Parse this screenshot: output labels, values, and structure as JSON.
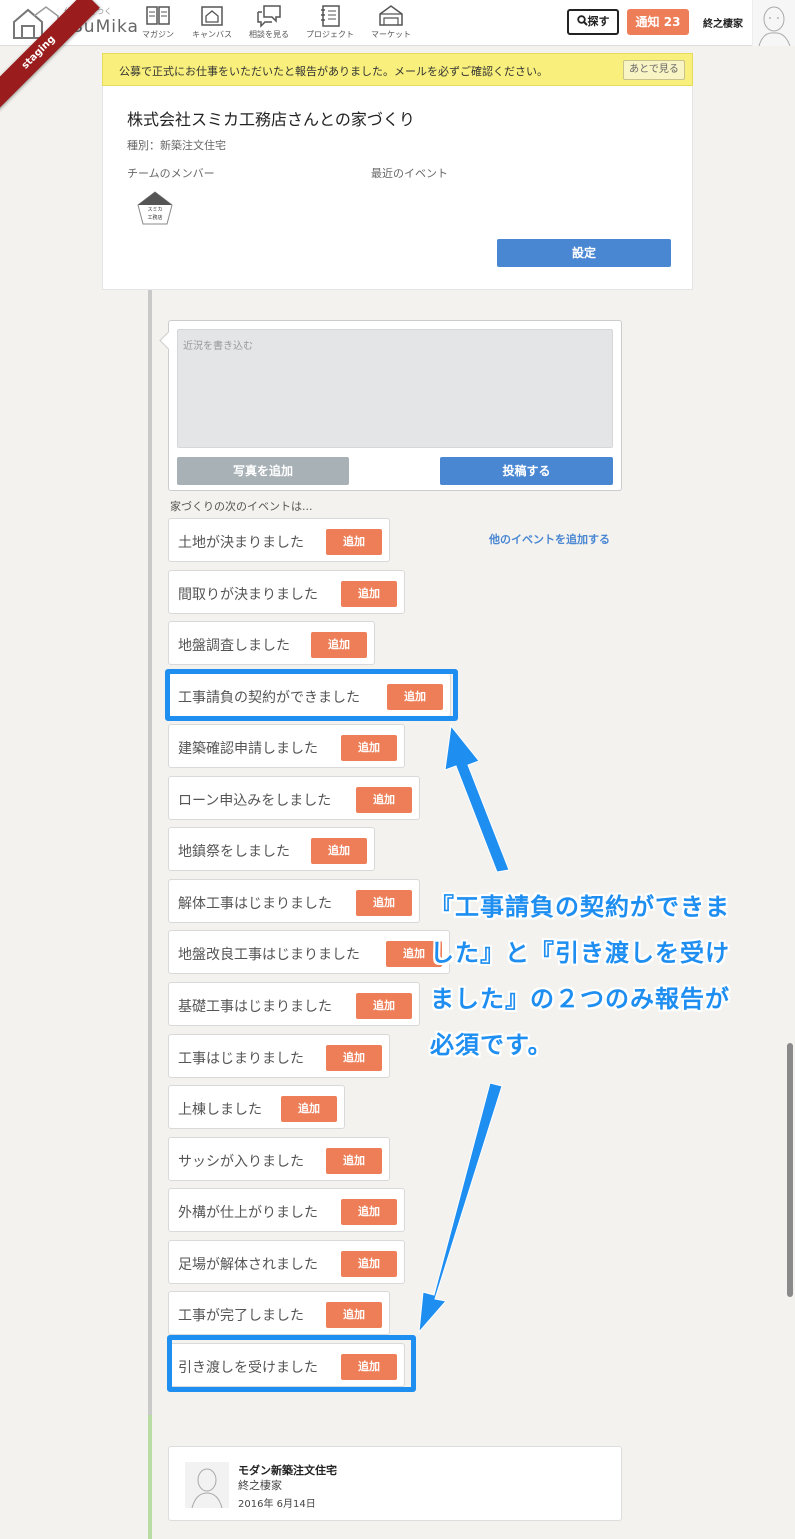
{
  "header": {
    "logo_kana": "住まいをつくろう",
    "logo_name": "SuMika",
    "nav": [
      {
        "label": "マガジン",
        "icon": "book-icon"
      },
      {
        "label": "キャンバス",
        "icon": "canvas-icon"
      },
      {
        "label": "相談を見る",
        "icon": "chat-icon"
      },
      {
        "label": "プロジェクト",
        "icon": "notebook-icon"
      },
      {
        "label": "マーケット",
        "icon": "market-icon"
      }
    ],
    "search_label": "探す",
    "notification_label": "通知",
    "notification_count": "23",
    "user_name": "終之棲家",
    "staging_label": "staging"
  },
  "notice": {
    "text": "公募で正式にお仕事をいただいたと報告がありました。メールを必ずご確認ください。",
    "later_label": "あとで見る"
  },
  "project": {
    "title": "株式会社スミカ工務店さんとの家づくり",
    "type": "種別：新築注文住宅",
    "members_label": "チームのメンバー",
    "events_label": "最近のイベント",
    "member_logo_text": "スミカ",
    "member_logo_sub": "工務店",
    "settings_label": "設定"
  },
  "post": {
    "placeholder": "近況を書き込む",
    "photo_label": "写真を追加",
    "submit_label": "投稿する"
  },
  "next_events_label": "家づくりの次のイベントは...",
  "other_events_label": "他のイベントを追加する",
  "add_label": "追加",
  "events": [
    "土地が決まりました",
    "間取りが決まりました",
    "地盤調査しました",
    "工事請負の契約ができました",
    "建築確認申請しました",
    "ローン申込みをしました",
    "地鎮祭をしました",
    "解体工事はじまりました",
    "地盤改良工事はじまりました",
    "基礎工事はじまりました",
    "工事はじまりました",
    "上棟しました",
    "サッシが入りました",
    "外構が仕上がりました",
    "足場が解体されました",
    "工事が完了しました",
    "引き渡しを受けました"
  ],
  "annotation": {
    "lines": [
      "『工事請負の契約ができま",
      "した』と『引き渡しを受け",
      "ました』の２つのみ報告が",
      "必須です。"
    ]
  },
  "feed": {
    "title": "モダン新築注文住宅",
    "author": "終之棲家",
    "date": "2016年 6月14日"
  },
  "colors": {
    "accent_orange": "#ee7e58",
    "accent_blue": "#4a87d3",
    "annotation_blue": "#1f8ef1",
    "notice_yellow": "#f8ef7c"
  }
}
